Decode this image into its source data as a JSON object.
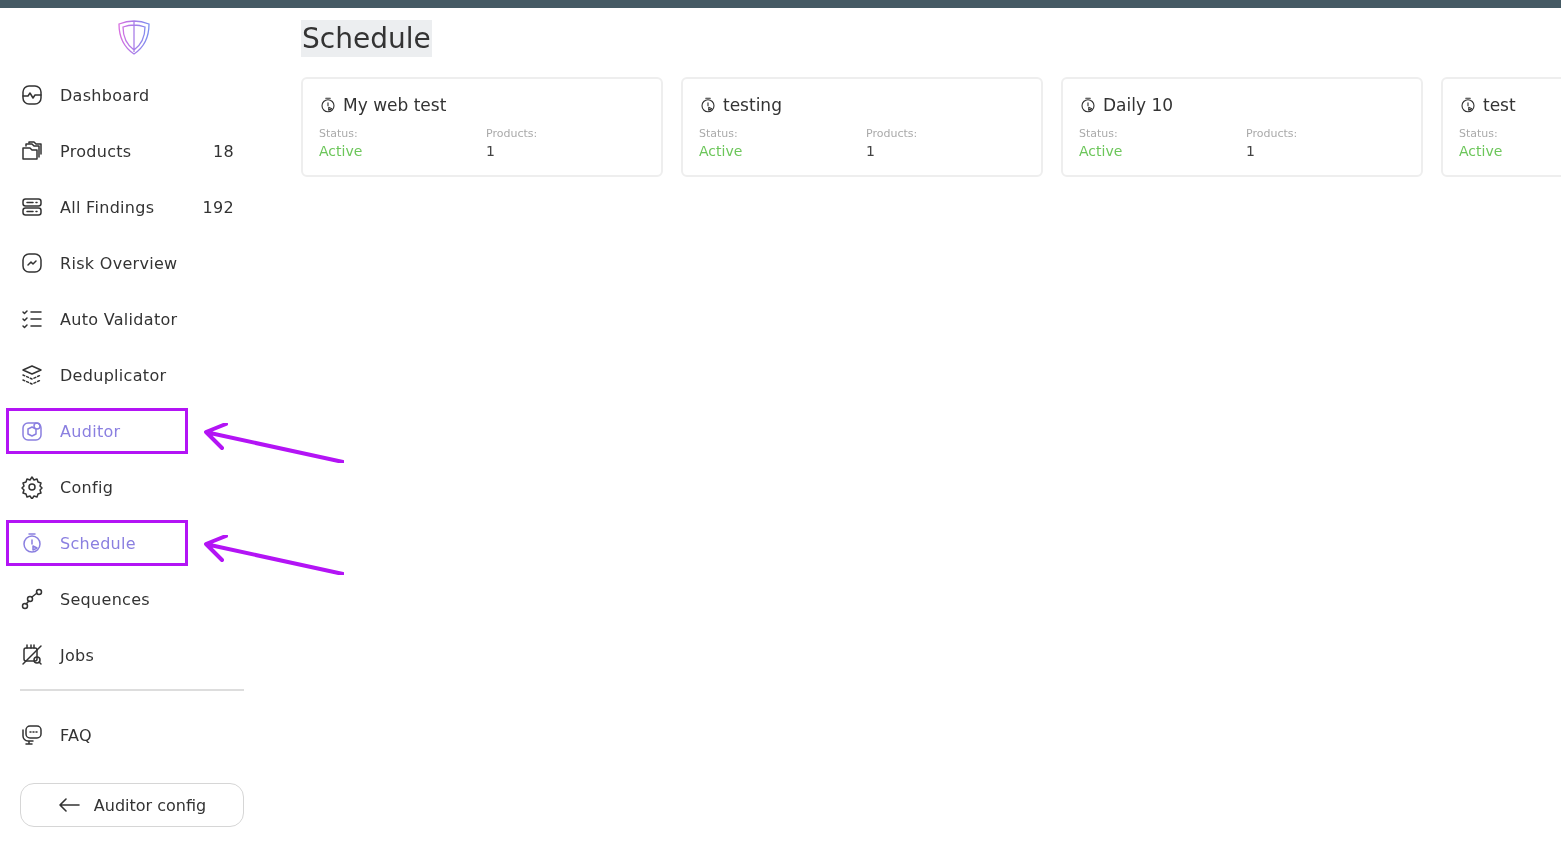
{
  "sidebar": {
    "items": [
      {
        "label": "Dashboard",
        "active": false,
        "annotated": false
      },
      {
        "label": "Products",
        "count": "18",
        "active": false,
        "annotated": false
      },
      {
        "label": "All Findings",
        "count": "192",
        "active": false,
        "annotated": false
      },
      {
        "label": "Risk Overview",
        "active": false,
        "annotated": false
      },
      {
        "label": "Auto Validator",
        "active": false,
        "annotated": false
      },
      {
        "label": "Deduplicator",
        "active": false,
        "annotated": false
      },
      {
        "label": "Auditor",
        "active": true,
        "annotated": true
      },
      {
        "label": "Config",
        "active": false,
        "annotated": false
      },
      {
        "label": "Schedule",
        "active": true,
        "annotated": true
      },
      {
        "label": "Sequences",
        "active": false,
        "annotated": false
      },
      {
        "label": "Jobs",
        "active": false,
        "annotated": false
      }
    ],
    "footer_items": [
      {
        "label": "FAQ",
        "active": false,
        "annotated": false
      }
    ],
    "back_button": "Auditor config"
  },
  "page_title": "Schedule",
  "cards": [
    {
      "title": "My web test",
      "status_label": "Status:",
      "status": "Active",
      "products_label": "Products:",
      "products": "1"
    },
    {
      "title": "testing",
      "status_label": "Status:",
      "status": "Active",
      "products_label": "Products:",
      "products": "1"
    },
    {
      "title": "Daily 10",
      "status_label": "Status:",
      "status": "Active",
      "products_label": "Products:",
      "products": "1"
    },
    {
      "title": "test",
      "status_label": "Status:",
      "status": "Active"
    }
  ]
}
